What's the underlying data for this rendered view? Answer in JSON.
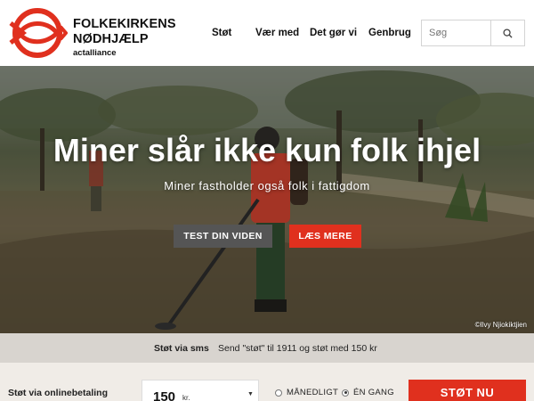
{
  "brand": {
    "line1": "FOLKEKIRKENS",
    "line2": "NØDHJÆLP",
    "line3": "actalliance",
    "logo_icon": "fish-circle-logo",
    "color": "#e0301e"
  },
  "nav": {
    "items": [
      {
        "label": "Støt"
      },
      {
        "label": "Vær med"
      },
      {
        "label": "Det gør vi"
      },
      {
        "label": "Genbrug"
      }
    ]
  },
  "search": {
    "placeholder": "Søg",
    "icon": "search-icon"
  },
  "hero": {
    "title": "Miner slår ikke kun folk ihjel",
    "subtitle": "Miner fastholder også folk i fattigdom",
    "btn_test": "TEST DIN VIDEN",
    "btn_read": "LÆS MERE",
    "credit": "©Ilvy Njiokiktjien"
  },
  "sms": {
    "label": "Støt via sms",
    "text": "Send \"støt\" til 1911 og støt med 150 kr"
  },
  "donate": {
    "label": "Støt via onlinebetaling",
    "amount": "150",
    "currency": "kr.",
    "monthly_label": "MÅNEDLIGT",
    "once_label": "ÉN GANG",
    "selected": "ÉN GANG",
    "button": "STØT NU"
  }
}
